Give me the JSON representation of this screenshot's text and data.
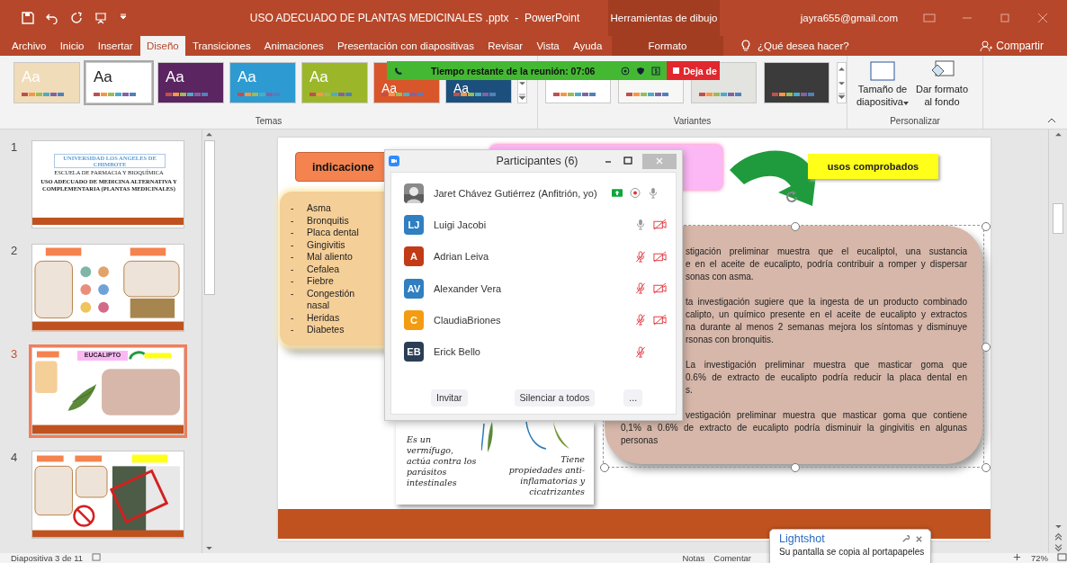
{
  "title_bar": {
    "title": "USO ADECUADO DE PLANTAS MEDICINALES .pptx  -  PowerPoint",
    "context_group": "Herramientas de dibujo",
    "account": "jayra655@gmail.com"
  },
  "ribbon_tabs": [
    {
      "label": "Archivo",
      "selected": false,
      "kind": "file"
    },
    {
      "label": "Inicio",
      "selected": false,
      "kind": "tab"
    },
    {
      "label": "Insertar",
      "selected": false,
      "kind": "tab"
    },
    {
      "label": "Diseño",
      "selected": true,
      "kind": "tab"
    },
    {
      "label": "Transiciones",
      "selected": false,
      "kind": "tab"
    },
    {
      "label": "Animaciones",
      "selected": false,
      "kind": "tab"
    },
    {
      "label": "Presentación con diapositivas",
      "selected": false,
      "kind": "tab"
    },
    {
      "label": "Revisar",
      "selected": false,
      "kind": "tab"
    },
    {
      "label": "Vista",
      "selected": false,
      "kind": "tab"
    },
    {
      "label": "Ayuda",
      "selected": false,
      "kind": "tab"
    },
    {
      "label": "Formato",
      "selected": false,
      "kind": "context"
    }
  ],
  "tell_me": "¿Qué desea hacer?",
  "share": "Compartir",
  "themes": {
    "label": "Temas",
    "items": [
      {
        "text": "Aa",
        "color": "#f0dcb8",
        "selected": false
      },
      {
        "text": "Aa",
        "color": "#ffffff",
        "selected": true
      },
      {
        "text": "Aa",
        "color": "#5a2560",
        "selected": false
      },
      {
        "text": "Aa",
        "color": "#2d9bd2",
        "selected": false
      },
      {
        "text": "Aa",
        "color": "#9cb62a",
        "selected": false
      },
      {
        "text": "Aa",
        "color": "#d9552a",
        "selected": false
      },
      {
        "text": "Aa",
        "color": "#1d4f7c",
        "selected": false
      }
    ]
  },
  "variants": {
    "label": "Variantes",
    "items": [
      {
        "color": "#ffffff"
      },
      {
        "color": "#f7f7f5"
      },
      {
        "color": "#e3e3df"
      },
      {
        "color": "#3b3b3b"
      }
    ]
  },
  "customize": {
    "label": "Personalizar",
    "buttons": [
      {
        "label": "Tamaño de diapositiva",
        "kind": "dropdown"
      },
      {
        "label": "Dar formato al fondo",
        "kind": "plain"
      }
    ]
  },
  "meeting_bar": {
    "timer": "Tiempo restante de la reunión: 07:06",
    "stop": "Deja de"
  },
  "thumbnails": [
    {
      "number": "1",
      "selected": false,
      "kind": "title",
      "texts": [
        "UNIVERSIDAD LOS ANGELES DE CHIMBOTE",
        "ESCUELA DE FARMACIA Y BIOQUÍMICA",
        "USO ADECUADO DE MEDICINA ALTERNATIVA Y COMPLEMENTARIA (PLANTAS MEDICINALES)"
      ]
    },
    {
      "number": "2",
      "selected": false,
      "kind": "content"
    },
    {
      "number": "3",
      "selected": true,
      "kind": "plant",
      "texts": [
        "EUCALIPTO"
      ]
    },
    {
      "number": "4",
      "selected": false,
      "kind": "warning"
    }
  ],
  "slide": {
    "indications": {
      "heading": "indicacione",
      "marker": "-",
      "items": [
        "Asma",
        "Bronquitis",
        "Placa dental",
        "Gingivitis",
        "Mal aliento",
        "Cefalea",
        "Fiebre",
        "Congestión nasal",
        "Heridas",
        "Diabetes"
      ]
    },
    "usage_heading": "usos comprobados",
    "evidence": [
      [
        "stigación preliminar muestra que el eucaliptol, una sustancia",
        "e en el aceite de eucalipto, podría contribuir a romper y dispersar",
        "sonas con asma."
      ],
      [
        "ta investigación sugiere que la ingesta de un producto combinado",
        "calipto, un químico presente en el aceite de eucalipto y extractos",
        "na durante al menos 2 semanas mejora los síntomas y disminuye",
        "rsonas con bronquitis."
      ],
      [
        "La investigación preliminar muestra que masticar goma que",
        "0.6% de extracto de eucalipto podría reducir la placa dental en",
        "s."
      ],
      [
        "vestigación preliminar muestra que masticar goma que contiene",
        "0,1% a 0.6% de extracto de eucalipto podría disminuir la gingivitis en algunas",
        "personas"
      ]
    ],
    "captions": [
      "Es un vermífugo, actúa contra los parásitos intestinales",
      "Tiene propiedades anti-inflamatorias y cicatrizantes"
    ]
  },
  "participants": {
    "title": "Participantes (6)",
    "people": [
      {
        "name": "Jaret Chávez Gutiérrez (Anfitrión, yo)",
        "sharing": true,
        "recording": true,
        "mic_muted": false,
        "video_off": false
      },
      {
        "name": "Luigi Jacobi",
        "kind": "initials",
        "initials": "LJ",
        "color": "#2f7fc1",
        "sharing": false,
        "recording": false,
        "mic_muted": false,
        "video_off": true
      },
      {
        "name": "Adrian Leiva",
        "kind": "initials",
        "initials": "A",
        "color": "#c23b16",
        "sharing": false,
        "recording": false,
        "mic_muted": true,
        "video_off": true
      },
      {
        "name": "Alexander Vera",
        "kind": "initials",
        "initials": "AV",
        "color": "#2f7fc1",
        "sharing": false,
        "recording": false,
        "mic_muted": true,
        "video_off": true
      },
      {
        "name": "ClaudiaBriones",
        "kind": "initials",
        "initials": "C",
        "color": "#f39c12",
        "sharing": false,
        "recording": false,
        "mic_muted": true,
        "video_off": true
      },
      {
        "name": "Erick Bello",
        "kind": "initials",
        "initials": "EB",
        "color": "#2b3e55",
        "sharing": false,
        "recording": false,
        "mic_muted": true,
        "video_off": false
      }
    ],
    "buttons": [
      "Invitar",
      "Silenciar a todos",
      "..."
    ]
  },
  "status_bar": {
    "slide": "Diapositiva 3 de 11",
    "notes": "Notas",
    "comments": "Comentar",
    "zoom": "72%"
  },
  "popup": {
    "title": "Lightshot",
    "message": "Su pantalla se copia al portapapeles"
  }
}
